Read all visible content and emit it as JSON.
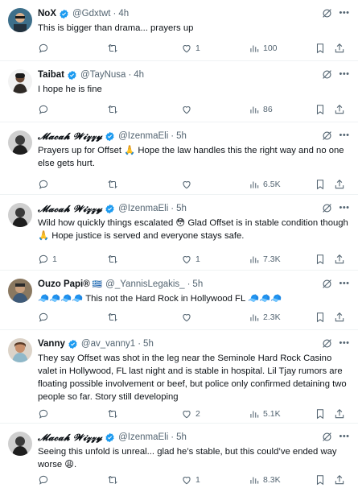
{
  "colors": {
    "verified": "#1d9bf0",
    "muted": "#536471",
    "text": "#0f1419",
    "divider": "#eff3f4"
  },
  "icons": {
    "verified": "verified-badge-icon",
    "grok": "grok-icon",
    "more": "more-icon",
    "reply": "reply-icon",
    "retweet": "retweet-icon",
    "like": "heart-icon",
    "views": "views-icon",
    "bookmark": "bookmark-icon",
    "share": "share-icon"
  },
  "tweets": [
    {
      "name": "NoX",
      "handle": "@Gdxtwt",
      "dot": "·",
      "time": "4h",
      "flag": "",
      "text": "This is bigger than drama... prayers up",
      "reply": "",
      "retweet": "",
      "like": "1",
      "views": "100"
    },
    {
      "name": "Taibat",
      "handle": "@TayNusa",
      "dot": "·",
      "time": "4h",
      "flag": "",
      "text": "I hope he is fine",
      "reply": "",
      "retweet": "",
      "like": "",
      "views": "86"
    },
    {
      "name": "𝓜𝓪𝓬𝓪𝓱 𝓦𝓲𝔃𝔃𝔂",
      "handle": "@IzenmaEli",
      "dot": "·",
      "time": "5h",
      "flag": "",
      "text": "Prayers up for Offset 🙏 Hope the law handles this the right way and no one else gets hurt.",
      "reply": "",
      "retweet": "",
      "like": "",
      "views": "6.5K"
    },
    {
      "name": "𝓜𝓪𝓬𝓪𝓱 𝓦𝓲𝔃𝔃𝔂",
      "handle": "@IzenmaEli",
      "dot": "·",
      "time": "5h",
      "flag": "",
      "text": "Wild how quickly things escalated 😳 Glad Offset is in stable condition though 🙏 Hope justice is served and everyone stays safe.",
      "reply": "1",
      "retweet": "",
      "like": "1",
      "views": "7.3K"
    },
    {
      "name": "Ouzo Papi®",
      "handle": "@_YannisLegakis_",
      "dot": "·",
      "time": "5h",
      "flag": "🇬🇷",
      "text": "🧢🧢🧢🧢 This not the Hard Rock in Hollywood FL 🧢🧢🧢",
      "reply": "",
      "retweet": "",
      "like": "",
      "views": "2.3K"
    },
    {
      "name": "Vanny",
      "handle": "@av_vanny1",
      "dot": "·",
      "time": "5h",
      "flag": "",
      "text": "They say Offset was shot in the leg near the Seminole Hard Rock Casino valet in Hollywood, FL last night and is stable in hospital. Lil Tjay rumors are floating possible involvement or beef, but police only confirmed detaining two people so far. Story still developing",
      "reply": "",
      "retweet": "",
      "like": "2",
      "views": "5.1K"
    },
    {
      "name": "𝓜𝓪𝓬𝓪𝓱 𝓦𝓲𝔃𝔃𝔂",
      "handle": "@IzenmaEli",
      "dot": "·",
      "time": "5h",
      "flag": "",
      "text": "Seeing this unfold is unreal... glad he’s stable, but this could’ve ended way worse 😩.",
      "reply": "",
      "retweet": "",
      "like": "1",
      "views": "8.3K"
    }
  ]
}
